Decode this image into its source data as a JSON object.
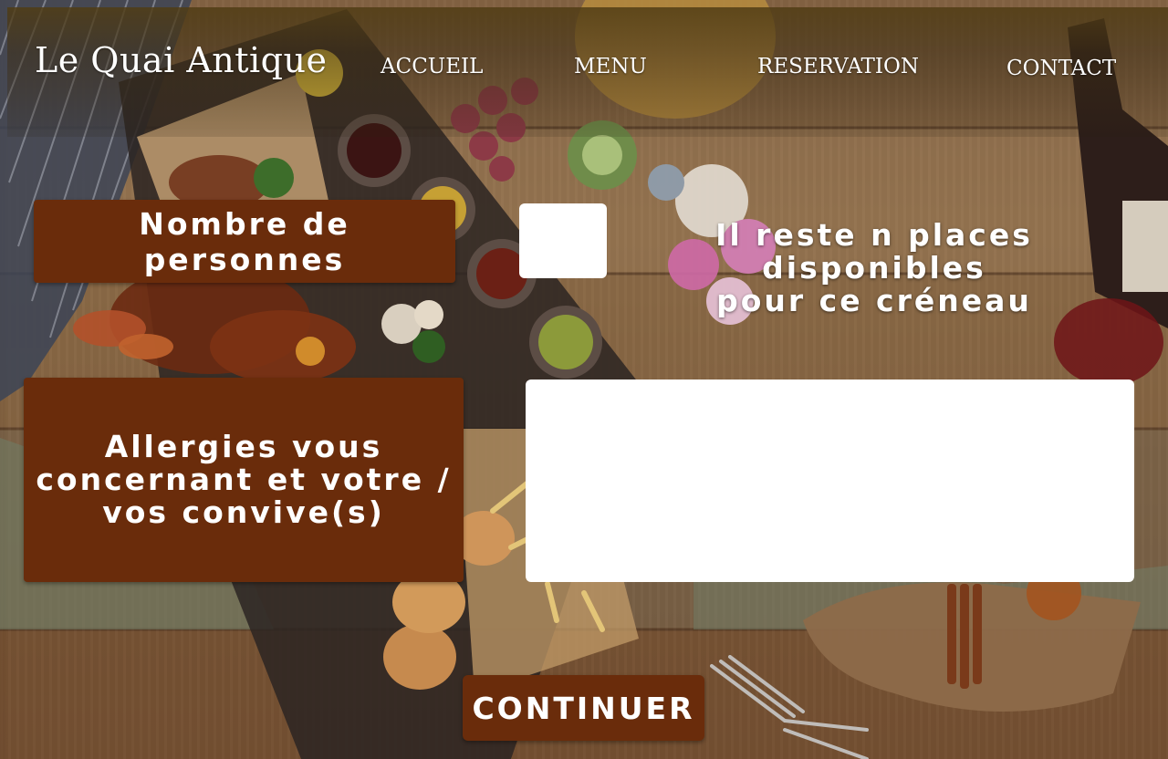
{
  "header": {
    "logo_text": "Le Quai Antique",
    "nav": [
      {
        "label": "ACCUEIL"
      },
      {
        "label": "MENU"
      },
      {
        "label": "RESERVATION"
      },
      {
        "label": "CONTACT"
      }
    ]
  },
  "form": {
    "persons_label": "Nombre de personnes",
    "persons_value": "",
    "availability_line1": "Il reste n places disponibles",
    "availability_line2": "pour ce créneau",
    "allergies_label": "Allergies vous concernant et votre / vos convive(s)",
    "allergies_value": "",
    "continue_label": "CONTINUER"
  },
  "colors": {
    "accent_brown": "#6a2c0b",
    "text_light": "#ffffff",
    "input_bg": "#ffffff"
  },
  "icons": []
}
